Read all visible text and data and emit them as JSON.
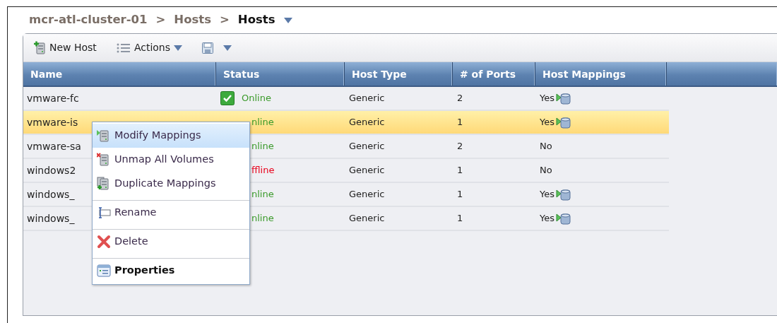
{
  "breadcrumb": [
    {
      "label": "mcr-atl-cluster-01",
      "current": false
    },
    {
      "label": "Hosts",
      "current": false
    },
    {
      "label": "Hosts",
      "current": true
    }
  ],
  "breadcrumb_separators": [
    ">",
    ">"
  ],
  "toolbar": [
    {
      "kind": "new",
      "label": "New Host"
    },
    {
      "kind": "actions",
      "label": "Actions"
    },
    {
      "kind": "save"
    }
  ],
  "table": {
    "columns": [
      "Name",
      "Status",
      "Host Type",
      "# of Ports",
      "Host Mappings"
    ],
    "rows": [
      {
        "name": "vmware-fc",
        "status": "Online",
        "color": "#3a9a2a",
        "status_icon": true,
        "host_type": "Generic",
        "ports": "2",
        "mappings": "Yes",
        "mapped": true,
        "selected": false
      },
      {
        "name": "vmware-is",
        "status": "nline",
        "color": "#3a9a2a",
        "status_icon": false,
        "host_type": "Generic",
        "ports": "1",
        "mappings": "Yes",
        "mapped": true,
        "selected": true
      },
      {
        "name": "vmware-sa",
        "status": "nline",
        "color": "#3a9a2a",
        "status_icon": false,
        "host_type": "Generic",
        "ports": "2",
        "mappings": "No",
        "mapped": false,
        "selected": false
      },
      {
        "name": "windows2",
        "status": "ffline",
        "color": "#e8001a",
        "status_icon": false,
        "host_type": "Generic",
        "ports": "1",
        "mappings": "No",
        "mapped": false,
        "selected": false
      },
      {
        "name": "windows_",
        "status": "nline",
        "color": "#3a9a2a",
        "status_icon": false,
        "host_type": "Generic",
        "ports": "1",
        "mappings": "Yes",
        "mapped": true,
        "selected": false
      },
      {
        "name": "windows_",
        "status": "nline",
        "color": "#3a9a2a",
        "status_icon": false,
        "host_type": "Generic",
        "ports": "1",
        "mappings": "Yes",
        "mapped": true,
        "selected": false
      }
    ]
  },
  "context_menu": [
    {
      "label": "Modify Mappings",
      "kind": "modify",
      "selected": true,
      "separator_before": false,
      "bold": false
    },
    {
      "label": "Unmap All Volumes",
      "kind": "unmap",
      "selected": false,
      "separator_before": false,
      "bold": false
    },
    {
      "label": "Duplicate Mappings",
      "kind": "duplicate",
      "selected": false,
      "separator_before": false,
      "bold": false
    },
    {
      "label": "Rename",
      "kind": "rename",
      "selected": false,
      "separator_before": true,
      "bold": false
    },
    {
      "label": "Delete",
      "kind": "delete",
      "selected": false,
      "separator_before": true,
      "bold": false
    },
    {
      "label": "Properties",
      "kind": "properties",
      "selected": false,
      "separator_before": true,
      "bold": true
    }
  ]
}
